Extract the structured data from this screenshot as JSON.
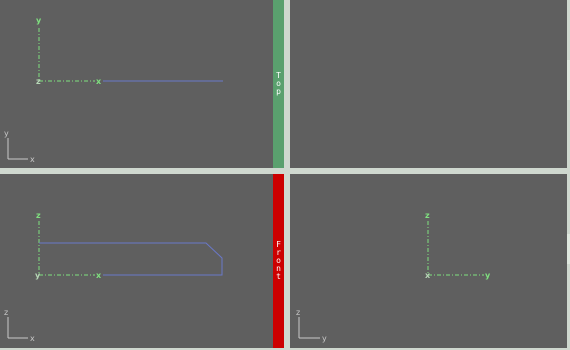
{
  "colors": {
    "viewport_bg": "#5f5f5f",
    "border": "#cfd8cf",
    "axis_green": "#7fe07f",
    "axis_dim": "#b6d6b6",
    "model_blue": "#6a78c8",
    "mini_axis": "#c8c8c8",
    "top_tab": "#5aa06e",
    "front_tab": "#cc0000"
  },
  "viewports": {
    "top_left": {
      "axes": {
        "vertical": "y",
        "horizontal": "x",
        "origin": "z"
      },
      "mini": {
        "vertical": "y",
        "horizontal": "x"
      }
    },
    "top_right": {
      "tag": ""
    },
    "bottom_left": {
      "axes": {
        "vertical": "z",
        "horizontal": "x",
        "origin": "y"
      },
      "mini": {
        "vertical": "z",
        "horizontal": "x"
      }
    },
    "bottom_right": {
      "axes": {
        "vertical": "z",
        "horizontal": "y",
        "origin": "x"
      },
      "mini": {
        "vertical": "z",
        "horizontal": "y"
      }
    }
  },
  "tabs": {
    "top_view": "Top",
    "front_view": "Front"
  }
}
